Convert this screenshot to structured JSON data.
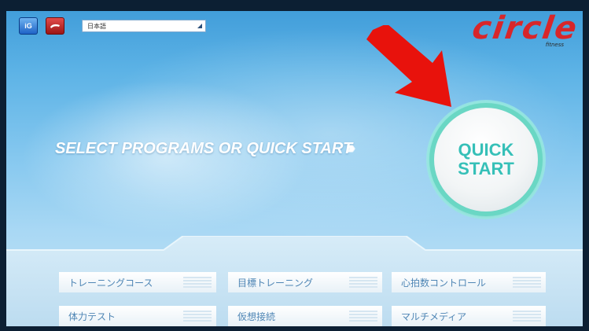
{
  "header": {
    "language_select_value": "日本語",
    "brand_name": "circle",
    "brand_sub": "fitness",
    "icons": [
      "app-icon-blue",
      "app-icon-red"
    ]
  },
  "main": {
    "headline": "SELECT PROGRAMS OR QUICK START",
    "quick_start_line1": "QUICK",
    "quick_start_line2": "START"
  },
  "programs": {
    "row1": [
      "トレーニングコース",
      "目標トレーニング",
      "心拍数コントロール"
    ],
    "row2": [
      "体力テスト",
      "仮想接続",
      "マルチメディア"
    ]
  },
  "colors": {
    "brand_red": "#d8262a",
    "quick_start_text": "#36c0b8",
    "quick_start_ring": "#6ad7c4",
    "program_text": "#4f86b5",
    "annotation_arrow": "#e8120c"
  }
}
